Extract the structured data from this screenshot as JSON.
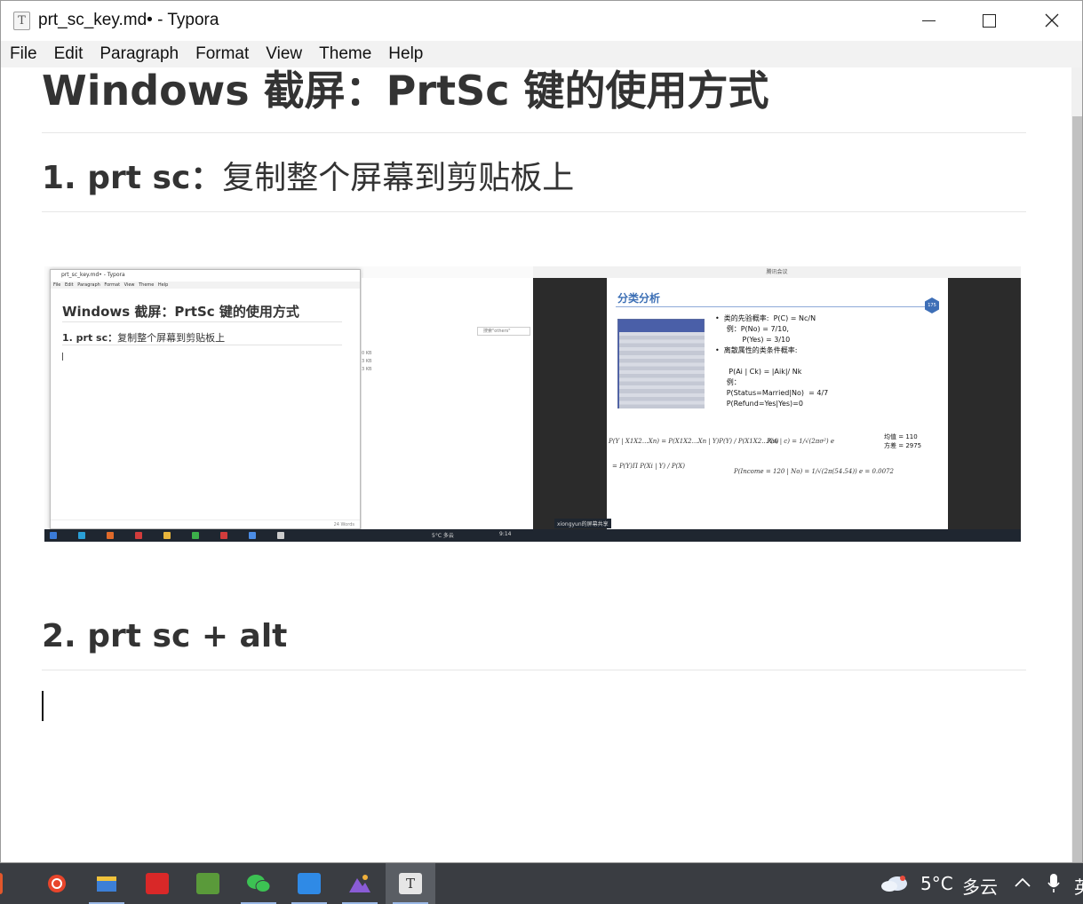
{
  "window": {
    "title": "prt_sc_key.md• - Typora",
    "icon_label": "T",
    "controls": [
      "minimize",
      "maximize",
      "close"
    ]
  },
  "menu": [
    "File",
    "Edit",
    "Paragraph",
    "Format",
    "View",
    "Theme",
    "Help"
  ],
  "document": {
    "h1": "Windows 截屏：PrtSc 键的使用方式",
    "h2_1_prefix": "1. prt sc：",
    "h2_1_text": "复制整个屏幕到剪贴板上",
    "h2_2": "2. prt sc + alt"
  },
  "embedded_screenshot": {
    "mini_title": "prt_sc_key.md• - Typora",
    "mini_menu": "File Edit Paragraph Format View Theme Help",
    "mini_h1": "Windows 截屏：PrtSc 键的使用方式",
    "mini_h2_prefix": "1. prt sc：",
    "mini_h2_text": "复制整个屏幕到剪贴板上",
    "mini_status": "24 Words",
    "explorer_search": "搜索\"others\"",
    "explorer_sizes": [
      "0 KB",
      "3 KB",
      "3 KB"
    ],
    "meeting_title": "腾讯会议",
    "slide_title": "分类分析",
    "slide_badge": "175",
    "slide_bullets": "•  类的先验概率:  P(C) = Nc/N\n     例：P(No) = 7/10,\n            P(Yes) = 3/10\n•  离散属性的类条件概率:\n\n      P(Ai | Ck) = |Aik|/ Nk\n     例：\n     P(Status=Married|No)  = 4/7\n     P(Refund=Yes|Yes)=0",
    "formula_bayes": "P(Y | X1X2…Xn) = P(X1X2…Xn | Y)P(Y) / P(X1X2…Xn)",
    "formula_bayes2": "= P(Y)Π P(Xi | Y) / P(X)",
    "formula_gauss": "P(A | c) = 1/√(2πσ²) e",
    "formula_income": "P(Income = 120 | No) = 1/√(2π(54.54)) e = 0.0072",
    "stats": "均值 = 110\n方差 = 2975",
    "share_label": "xiongyun的屏幕共享",
    "taskbar_weather": "5°C 多云",
    "taskbar_time": "9:14"
  },
  "taskbar": {
    "apps": [
      "app-orange",
      "snail-app",
      "mail-app",
      "files-app",
      "money-app",
      "wechat",
      "feishu",
      "photos",
      "typora"
    ],
    "active_app": "typora",
    "weather": "5°C",
    "weather_desc": "多云",
    "ime": "英"
  }
}
